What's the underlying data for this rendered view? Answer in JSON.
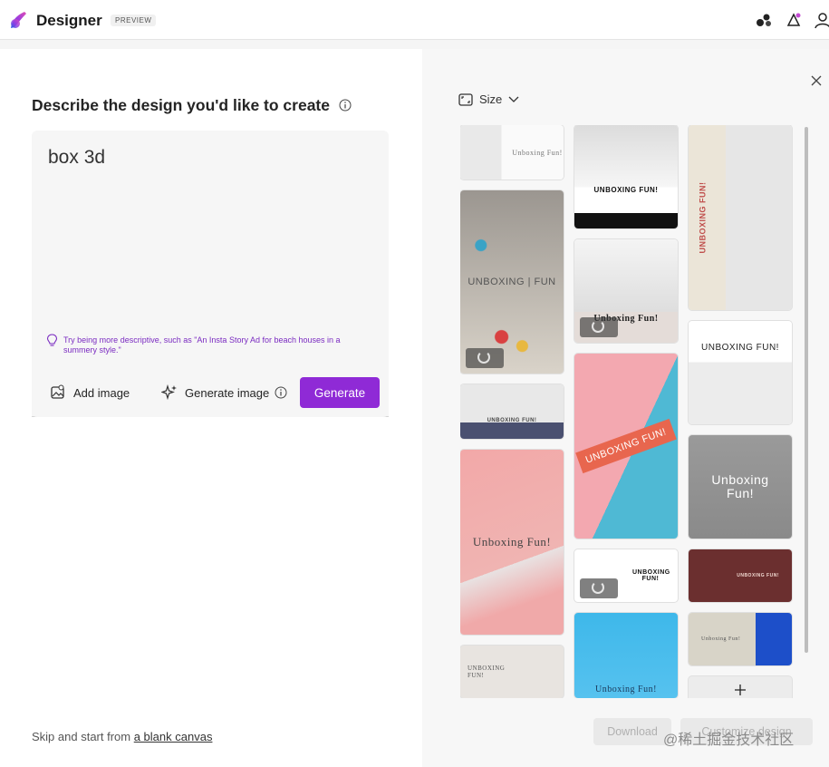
{
  "app": {
    "name": "Designer",
    "badge": "PREVIEW"
  },
  "topbar_icons": [
    "apps-icon",
    "sparkle-icon",
    "account-icon"
  ],
  "left": {
    "heading": "Describe the design you'd like to create",
    "prompt_value": "box 3d",
    "hint": "Try being more descriptive, such as \"An Insta Story Ad for beach houses in a summery style.\"",
    "add_image_label": "Add image",
    "generate_image_label": "Generate image",
    "generate_label": "Generate",
    "skip_prefix": "Skip and start from ",
    "skip_link": "a blank canvas"
  },
  "right": {
    "size_label": "Size",
    "download_label": "Download",
    "customize_label": "Customize design"
  },
  "cards": {
    "c1": "Unboxing Fun!",
    "c2": "UNBOXING FUN!",
    "c3": "UNBOXING FUN!",
    "c4": "UNBOXING | FUN",
    "c5": "Unboxing Fun!",
    "c6": "UNBOXING FUN!",
    "c7": "UNBOXING FUN!",
    "c8": "Unboxing Fun!",
    "c9": "UNBOXING FUN!",
    "c10": "UNBOXING FUN!",
    "c11": "Unboxing Fun!",
    "c12": "UNBOXING FUN!",
    "c13": "Unboxing Fun!",
    "c14": "UNBOXING FUN!",
    "c15": "Unboxing Fun!"
  },
  "watermark": "@稀土掘金技术社区",
  "colors": {
    "accent": "#8f2ad6",
    "hint": "#7b2cc1"
  }
}
